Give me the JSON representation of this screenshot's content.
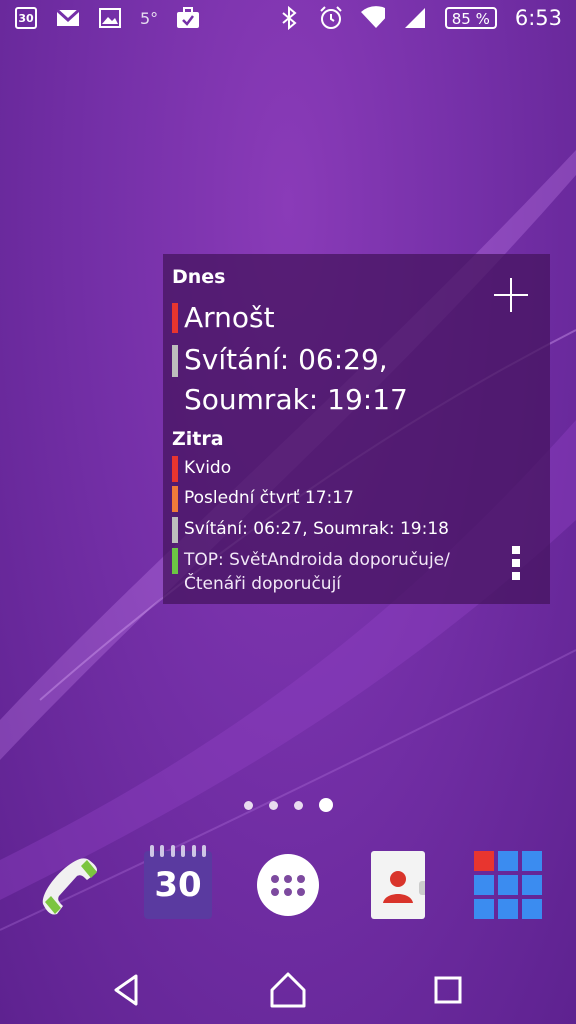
{
  "status_bar": {
    "calendar_day": "30",
    "temperature": "5°",
    "battery": "85 %",
    "time": "6:53",
    "left_icons": [
      "calendar-icon",
      "gmail-icon",
      "gallery-icon",
      "temperature",
      "task-icon"
    ],
    "right_icons": [
      "bluetooth-icon",
      "alarm-icon",
      "wifi-icon",
      "signal-icon",
      "battery-icon"
    ]
  },
  "widget": {
    "today_heading": "Dnes",
    "today_events": [
      {
        "text": "Arnošt",
        "color": "#e8352f"
      },
      {
        "text": "Svítání: 06:29, Soumrak: 19:17",
        "color": "#bdbdbd"
      }
    ],
    "tomorrow_heading": "Zitra",
    "tomorrow_events": [
      {
        "text": "Kvido",
        "color": "#e8352f"
      },
      {
        "text": "Poslední čtvrť 17:17",
        "color": "#f07a3a"
      },
      {
        "text": "Svítání: 06:27, Soumrak: 19:18",
        "color": "#bdbdbd"
      },
      {
        "text": "TOP: SvětAndroida doporučuje/Čtenáři doporučují",
        "color": "#6cc644"
      }
    ]
  },
  "home_pages": {
    "count": 4,
    "active_index": 3
  },
  "dock": {
    "calendar_day": "30",
    "apps": [
      "phone",
      "calendar",
      "app-drawer",
      "contacts",
      "xperia-apps"
    ]
  },
  "nav": [
    "back",
    "home",
    "recents"
  ],
  "colors": {
    "background": "#7530a8",
    "widget_bg": "#46145f"
  }
}
